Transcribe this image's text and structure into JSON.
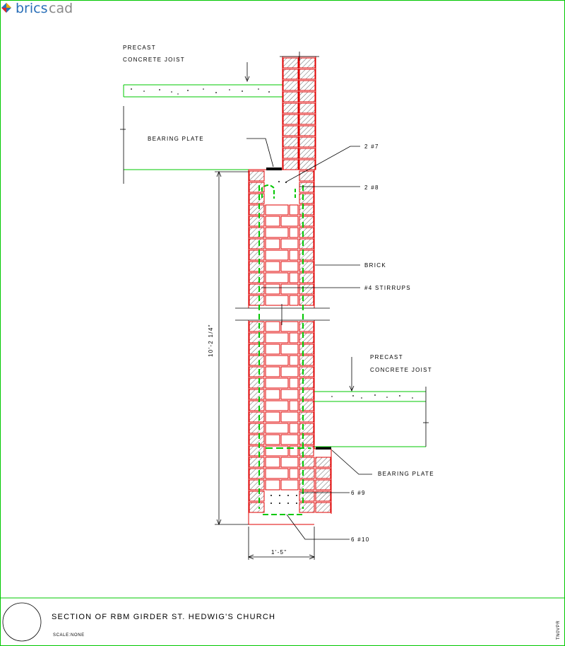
{
  "app": {
    "logo_part1": "brics",
    "logo_part2": "cad"
  },
  "colors": {
    "brick": "#e00000",
    "concrete": "#00c800",
    "logo_blue": "#2a6fb8",
    "logo_grey": "#8a8a8a"
  },
  "labels": {
    "precast_top_1": "PRECAST",
    "precast_top_2": "CONCRETE JOIST",
    "bearing_plate_top": "BEARING PLATE",
    "bar_2_7": "2 #7",
    "bar_2_8": "2 #8",
    "brick": "BRICK",
    "stirrups": "#4 STIRRUPS",
    "dimension_height": "10'-2 1/4\"",
    "precast_bottom_1": "PRECAST",
    "precast_bottom_2": "CONCRETE JOIST",
    "bearing_plate_bottom": "BEARING PLATE",
    "bar_6_9": "6 #9",
    "bar_6_10": "6 #10",
    "dimension_width": "1'-5\""
  },
  "title_block": {
    "title": "SECTION OF RBM GIRDER ST. HEDWIG'S CHURCH",
    "scale": "SCALE:NONE",
    "code": "TN0VPR"
  },
  "icons": {
    "logo": "bricscad-logo-icon",
    "title_circle": "detail-circle-icon"
  }
}
